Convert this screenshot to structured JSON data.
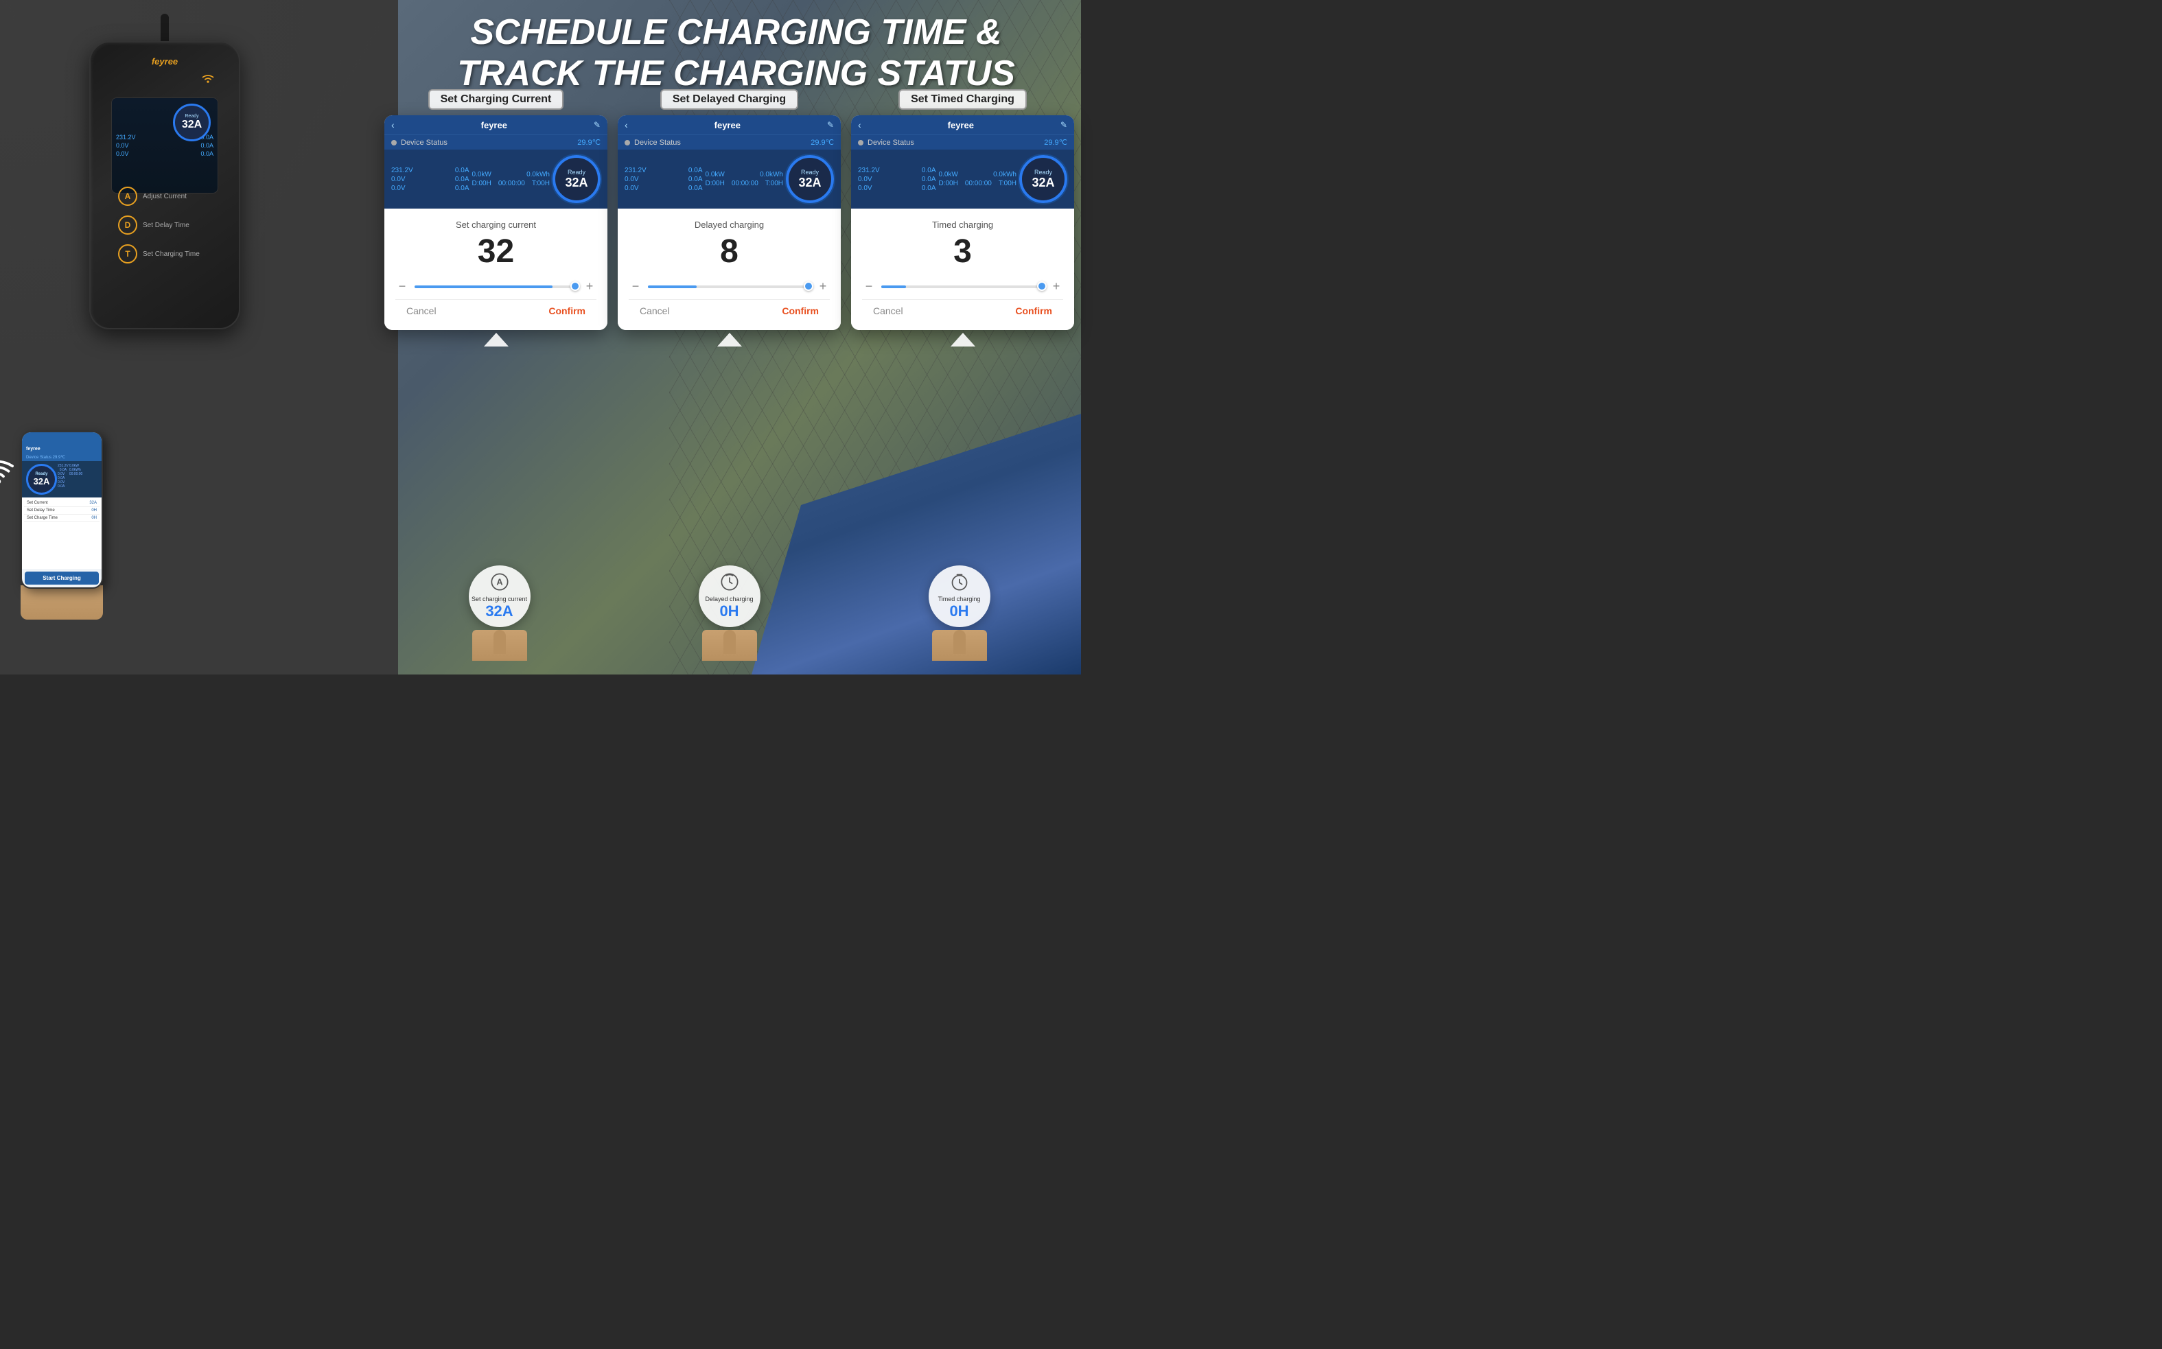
{
  "page": {
    "title": "Schedule Charging Time & Track The Charging Status",
    "title_line1": "SCHEDULE CHARGING TIME &",
    "title_line2": "TRACK THE CHARGING STATUS"
  },
  "panels": [
    {
      "id": "set-charging-current",
      "label": "Set Charging Current",
      "app_title": "feyree",
      "device_status": "Device Status",
      "temperature": "29.9℃",
      "voltage1": "231.2V",
      "current1": "0.0A",
      "voltage2": "0.0V",
      "current2": "0.0A",
      "voltage3": "0.0V",
      "current3": "0.0A",
      "power": "0.0kW",
      "energy": "0.0kWh",
      "duration": "D:00H",
      "time": "00:00:00",
      "timer": "T:00H",
      "gauge_status": "Ready",
      "gauge_value": "32A",
      "dialog_title": "Set charging current",
      "dialog_value": "32",
      "slider_fill_pct": 85,
      "cancel_label": "Cancel",
      "confirm_label": "Confirm"
    },
    {
      "id": "delayed-charging",
      "label": "Set Delayed Charging",
      "app_title": "feyree",
      "device_status": "Device Status",
      "temperature": "29.9℃",
      "voltage1": "231.2V",
      "current1": "0.0A",
      "voltage2": "0.0V",
      "current2": "0.0A",
      "voltage3": "0.0V",
      "current3": "0.0A",
      "power": "0.0kW",
      "energy": "0.0kWh",
      "duration": "D:00H",
      "time": "00:00:00",
      "timer": "T:00H",
      "gauge_status": "Ready",
      "gauge_value": "32A",
      "dialog_title": "Delayed charging",
      "dialog_value": "8",
      "slider_fill_pct": 30,
      "cancel_label": "Cancel",
      "confirm_label": "Confirm"
    },
    {
      "id": "timed-charging",
      "label": "Set Timed Charging",
      "app_title": "feyree",
      "device_status": "Device Status",
      "temperature": "29.9℃",
      "voltage1": "231.2V",
      "current1": "0.0A",
      "voltage2": "0.0V",
      "current2": "0.0A",
      "voltage3": "0.0V",
      "current3": "0.0A",
      "power": "0.0kW",
      "energy": "0.0kWh",
      "duration": "D:00H",
      "time": "00:00:00",
      "timer": "T:00H",
      "gauge_status": "Ready",
      "gauge_value": "32A",
      "dialog_title": "Timed charging",
      "dialog_value": "3",
      "slider_fill_pct": 15,
      "cancel_label": "Cancel",
      "confirm_label": "Confirm"
    }
  ],
  "bottom_buttons": [
    {
      "icon": "Ⓐ",
      "label": "Set charging\ncurrent",
      "value": "32A"
    },
    {
      "icon": "↺",
      "label": "Delayed charging",
      "value": "0H"
    },
    {
      "icon": "⏱",
      "label": "Timed charging",
      "value": "0H"
    }
  ],
  "charger": {
    "brand": "feyree",
    "wifi_icon": "wifi",
    "btn_a_label": "Adjust Current",
    "btn_d_label": "Set Delay Time",
    "btn_t_label": "Set Charging Time"
  },
  "phone": {
    "app_name": "feyree",
    "device_status": "Device Status  29.9℃",
    "metrics": [
      "231.2V",
      "0.0A",
      "0.0V",
      "0.0A",
      "0.0V",
      "0.0A"
    ],
    "power": "0.0kW",
    "energy": "0.0kWh",
    "duration": "D:00H",
    "time": "00:00:00",
    "timer": "T:00H",
    "gauge_value": "32A",
    "list_items": [
      {
        "label": "Set Current",
        "value": "32A"
      },
      {
        "label": "Set Delay Time",
        "value": "0H"
      },
      {
        "label": "Set Charge Time",
        "value": "0H"
      }
    ],
    "start_btn": "Start Charging"
  }
}
